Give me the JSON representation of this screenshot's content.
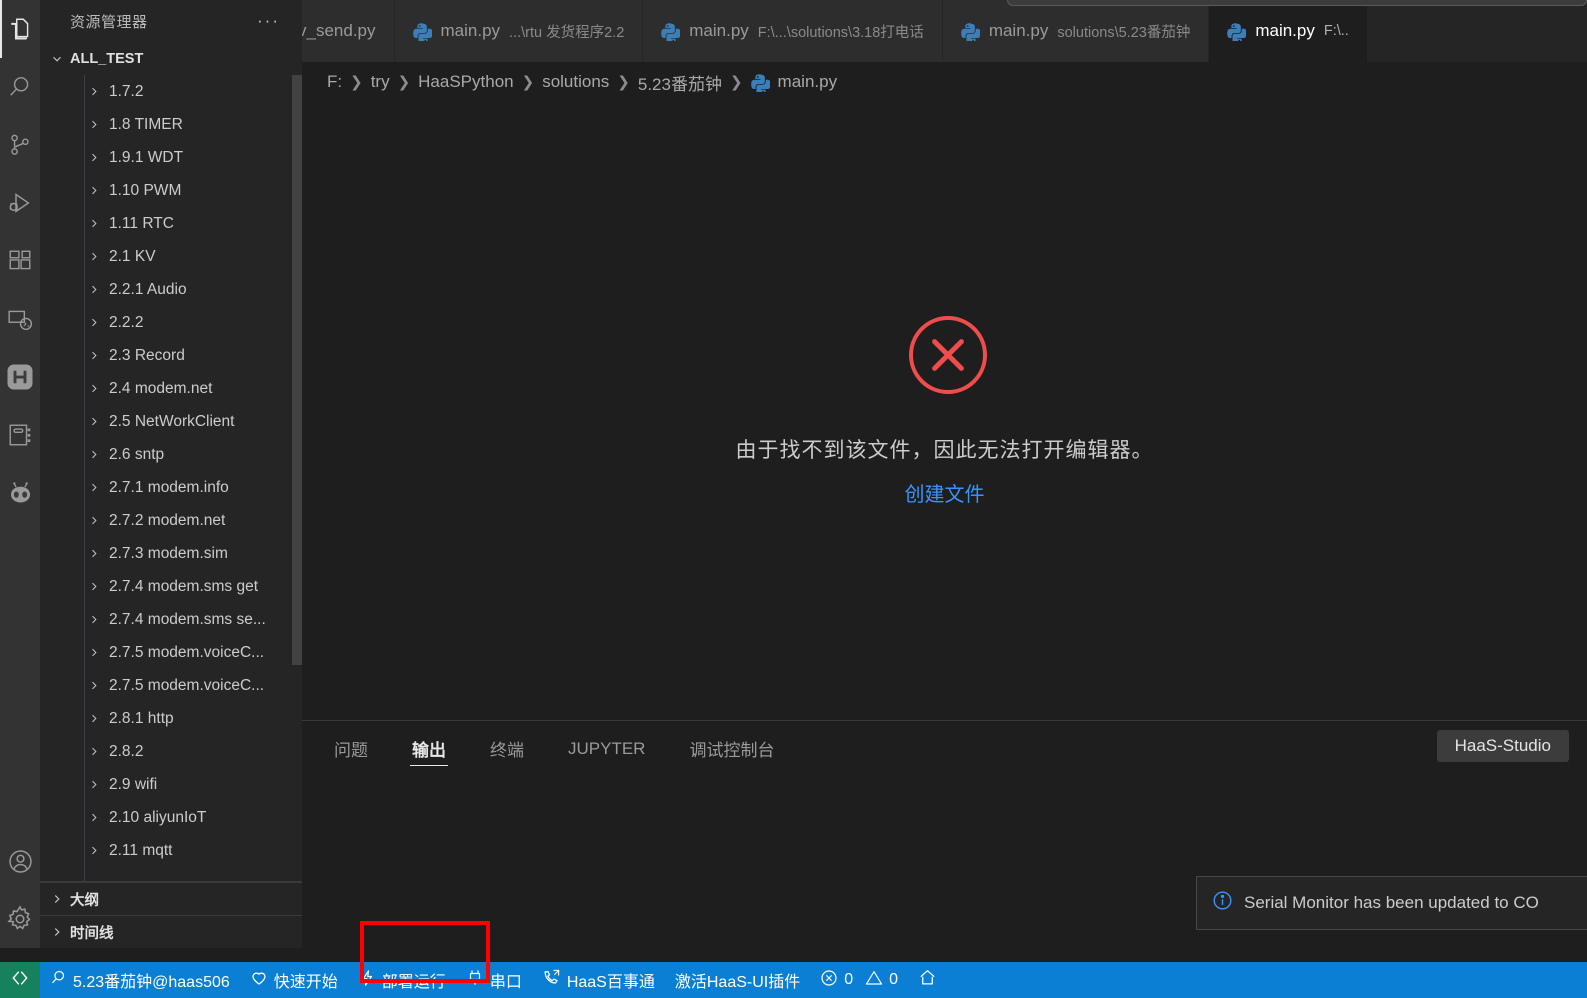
{
  "activitybar": {
    "items": [
      {
        "name": "explorer",
        "icon": "files-icon",
        "label": "资源管理器",
        "active": true
      },
      {
        "name": "search",
        "icon": "search-icon",
        "label": "搜索",
        "active": false
      },
      {
        "name": "source-control",
        "icon": "source-control-icon",
        "label": "源代码管理",
        "active": false
      },
      {
        "name": "run-debug",
        "icon": "run-and-debug-icon",
        "label": "运行和调试",
        "active": false
      },
      {
        "name": "extensions",
        "icon": "extensions-icon",
        "label": "扩展",
        "active": false
      },
      {
        "name": "remote-explorer",
        "icon": "remote-explorer-icon",
        "label": "远程资源管理器",
        "active": false
      },
      {
        "name": "haas-studio",
        "icon": "haas-h-icon",
        "label": "HaaS Studio",
        "active": false
      },
      {
        "name": "notebook",
        "icon": "notebook-icon",
        "label": "笔记本",
        "active": false
      },
      {
        "name": "copilot",
        "icon": "alien-icon",
        "label": "Copilot",
        "active": false
      }
    ],
    "bottom": [
      {
        "name": "accounts",
        "icon": "account-icon",
        "label": "账户"
      },
      {
        "name": "settings",
        "icon": "gear-icon",
        "label": "管理"
      }
    ]
  },
  "sidebar": {
    "title": "资源管理器",
    "more_actions": "···",
    "root_section": {
      "label": "ALL_TEST",
      "expanded": true
    },
    "tree": [
      {
        "label": "1.7.2"
      },
      {
        "label": "1.8 TIMER"
      },
      {
        "label": "1.9.1 WDT"
      },
      {
        "label": "1.10  PWM"
      },
      {
        "label": "1.11 RTC"
      },
      {
        "label": "2.1 KV"
      },
      {
        "label": "2.2.1 Audio"
      },
      {
        "label": "2.2.2"
      },
      {
        "label": "2.3 Record"
      },
      {
        "label": "2.4 modem.net"
      },
      {
        "label": "2.5 NetWorkClient"
      },
      {
        "label": "2.6 sntp"
      },
      {
        "label": "2.7.1 modem.info"
      },
      {
        "label": "2.7.2 modem.net"
      },
      {
        "label": "2.7.3 modem.sim"
      },
      {
        "label": "2.7.4 modem.sms get"
      },
      {
        "label": "2.7.4 modem.sms se..."
      },
      {
        "label": "2.7.5 modem.voiceC..."
      },
      {
        "label": "2.7.5 modem.voiceC..."
      },
      {
        "label": "2.8.1 http"
      },
      {
        "label": "2.8.2"
      },
      {
        "label": "2.9 wifi"
      },
      {
        "label": "2.10 aliyunIoT"
      },
      {
        "label": "2.11 mqtt"
      }
    ],
    "sections": [
      {
        "label": "大纲",
        "expanded": false
      },
      {
        "label": "时间线",
        "expanded": false
      }
    ]
  },
  "tabs": [
    {
      "label": "v_send.py",
      "sub": "",
      "icon": "",
      "active": false,
      "truncated_left": true
    },
    {
      "label": "main.py",
      "sub": "...\\rtu 发货程序2.2",
      "icon": "python-icon",
      "active": false
    },
    {
      "label": "main.py",
      "sub": "F:\\...\\solutions\\3.18打电话",
      "icon": "python-icon",
      "active": false
    },
    {
      "label": "main.py",
      "sub": "solutions\\5.23番茄钟",
      "icon": "python-icon",
      "active": false
    },
    {
      "label": "main.py",
      "sub": "F:\\..",
      "icon": "python-icon",
      "active": true
    }
  ],
  "breadcrumb": {
    "separator": "❯",
    "items": [
      "F:",
      "try",
      "HaaSPython",
      "solutions",
      "5.23番茄钟"
    ],
    "file": "main.py",
    "file_icon": "python-icon"
  },
  "editor": {
    "error_icon": "error-x-icon",
    "message": "由于找不到该文件，因此无法打开编辑器。",
    "action_link": "创建文件",
    "error_color": "#f14c4c",
    "link_color": "#3794ff"
  },
  "panel": {
    "tabs": [
      {
        "label": "问题",
        "active": false
      },
      {
        "label": "输出",
        "active": true
      },
      {
        "label": "终端",
        "active": false
      },
      {
        "label": "JUPYTER",
        "active": false
      },
      {
        "label": "调试控制台",
        "active": false
      }
    ],
    "source_selector": "HaaS-Studio"
  },
  "notification": {
    "icon": "info-icon",
    "message": "Serial Monitor has been updated to CO"
  },
  "statusbar": {
    "background": "#0a7fd4",
    "remote_background": "#16825d",
    "remote_icon": "remote-icon",
    "items": [
      {
        "name": "device-target",
        "icon": "search-icon",
        "label": "5.23番茄钟@haas506"
      },
      {
        "name": "quick-start",
        "icon": "heart-icon",
        "label": "快速开始"
      },
      {
        "name": "deploy-run",
        "icon": "lightning-icon",
        "label": "部署运行",
        "highlighted": true
      },
      {
        "name": "serial-port",
        "icon": "plug-icon",
        "label": "串口"
      },
      {
        "name": "haas-help",
        "icon": "call-icon",
        "label": "HaaS百事通"
      },
      {
        "name": "activate-haas-ui",
        "icon": "",
        "label": "激活HaaS-UI插件"
      },
      {
        "name": "problems",
        "icon": "error-circle-icon",
        "label": "0",
        "icon2": "warning-triangle-icon",
        "label2": "0"
      },
      {
        "name": "home",
        "icon": "home-icon",
        "label": ""
      }
    ]
  },
  "highlight": {
    "color": "#ff0000",
    "target": "deploy-run"
  }
}
